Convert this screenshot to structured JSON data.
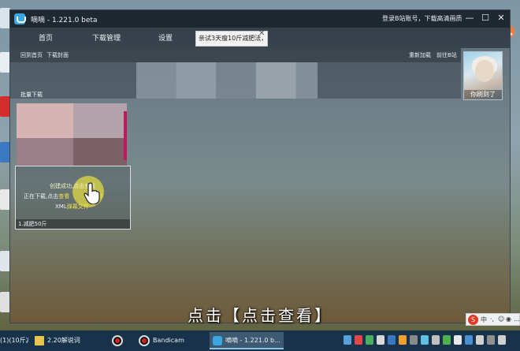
{
  "window": {
    "title": "嘀嘀 - 1.221.0 beta",
    "login_text": "登录B站账号，下载高清画质",
    "minimize": "—",
    "maximize": "☐",
    "close": "✕"
  },
  "nav": {
    "tabs": [
      "首页",
      "下载管理",
      "设置"
    ],
    "search_value": "亲试3天瘦10斤减肥法，7",
    "search_clear": "✕"
  },
  "toolbar": {
    "back_home": "回到首页",
    "download_cover": "下载封面",
    "refresh": "重新加载",
    "goto_bilibili": "前往B站"
  },
  "section": {
    "label": "批量下载"
  },
  "avatar": {
    "caption": "你刷到了"
  },
  "card": {
    "line1": "创建成功,点击查看",
    "line2_prefix": "正在下载,点击",
    "line2_link": "查看",
    "line2_suffix": "源文件",
    "line3_prefix": "XML",
    "line3_link": "弹幕文件",
    "footer": "1.减肥50斤"
  },
  "subtitle": "点击【点击查看】",
  "ime": {
    "s": "S",
    "zh": "中",
    "punct": "·,",
    "emoji": "☺",
    "mic": "◉",
    "more": "…"
  },
  "taskbar": {
    "items": [
      {
        "label": "(1)(10斤减..."
      },
      {
        "label": "2.20解说词"
      },
      {
        "label": ""
      },
      {
        "label": "Bandicam"
      },
      {
        "label": "嘀嘀 - 1.221.0 b..."
      }
    ]
  },
  "colors": {
    "accent_blue": "#3aa7e0",
    "card_link_yellow": "#f0e44a",
    "taskbar": "#17324a"
  }
}
